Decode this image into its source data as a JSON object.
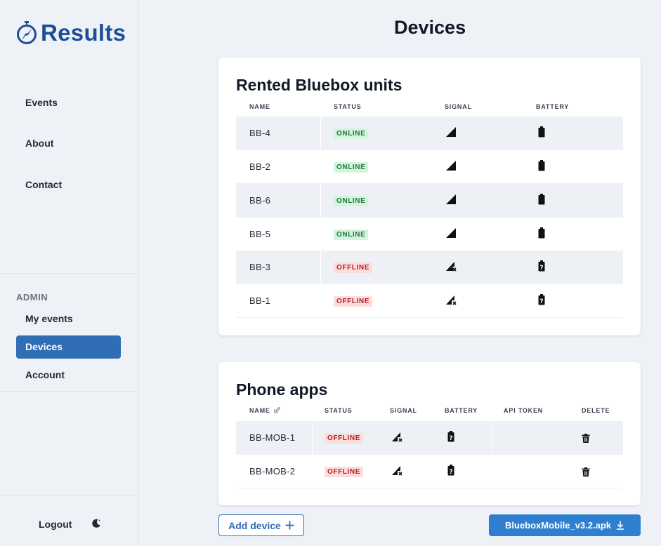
{
  "app": {
    "name": "Results"
  },
  "sidebar": {
    "nav": [
      {
        "label": "Events"
      },
      {
        "label": "About"
      },
      {
        "label": "Contact"
      }
    ],
    "admin_label": "ADMIN",
    "admin_items": [
      {
        "label": "My events"
      },
      {
        "label": "Devices",
        "active": true
      },
      {
        "label": "Account"
      }
    ],
    "logout": "Logout"
  },
  "page": {
    "title": "Devices"
  },
  "rented": {
    "title": "Rented Bluebox units",
    "headers": {
      "name": "NAME",
      "status": "STATUS",
      "signal": "SIGNAL",
      "battery": "BATTERY"
    },
    "rows": [
      {
        "name": "BB-4",
        "status": "ONLINE",
        "signal": "full",
        "battery": "full"
      },
      {
        "name": "BB-2",
        "status": "ONLINE",
        "signal": "full",
        "battery": "full"
      },
      {
        "name": "BB-6",
        "status": "ONLINE",
        "signal": "full",
        "battery": "full"
      },
      {
        "name": "BB-5",
        "status": "ONLINE",
        "signal": "full",
        "battery": "full"
      },
      {
        "name": "BB-3",
        "status": "OFFLINE",
        "signal": "none",
        "battery": "unknown"
      },
      {
        "name": "BB-1",
        "status": "OFFLINE",
        "signal": "none",
        "battery": "unknown"
      }
    ]
  },
  "phone": {
    "title": "Phone apps",
    "headers": {
      "name": "NAME",
      "status": "STATUS",
      "signal": "SIGNAL",
      "battery": "BATTERY",
      "api_token": "API TOKEN",
      "delete": "DELETE"
    },
    "rows": [
      {
        "name": "BB-MOB-1",
        "status": "OFFLINE",
        "signal": "none",
        "battery": "unknown"
      },
      {
        "name": "BB-MOB-2",
        "status": "OFFLINE",
        "signal": "none",
        "battery": "unknown"
      }
    ]
  },
  "actions": {
    "add_device": "Add device",
    "download_apk": "BlueboxMobile_v3.2.apk"
  },
  "colors": {
    "brand": "#1d4f97",
    "primary": "#2f6db5",
    "online_bg": "#d4f4dd",
    "offline_bg": "#fddcdc"
  }
}
